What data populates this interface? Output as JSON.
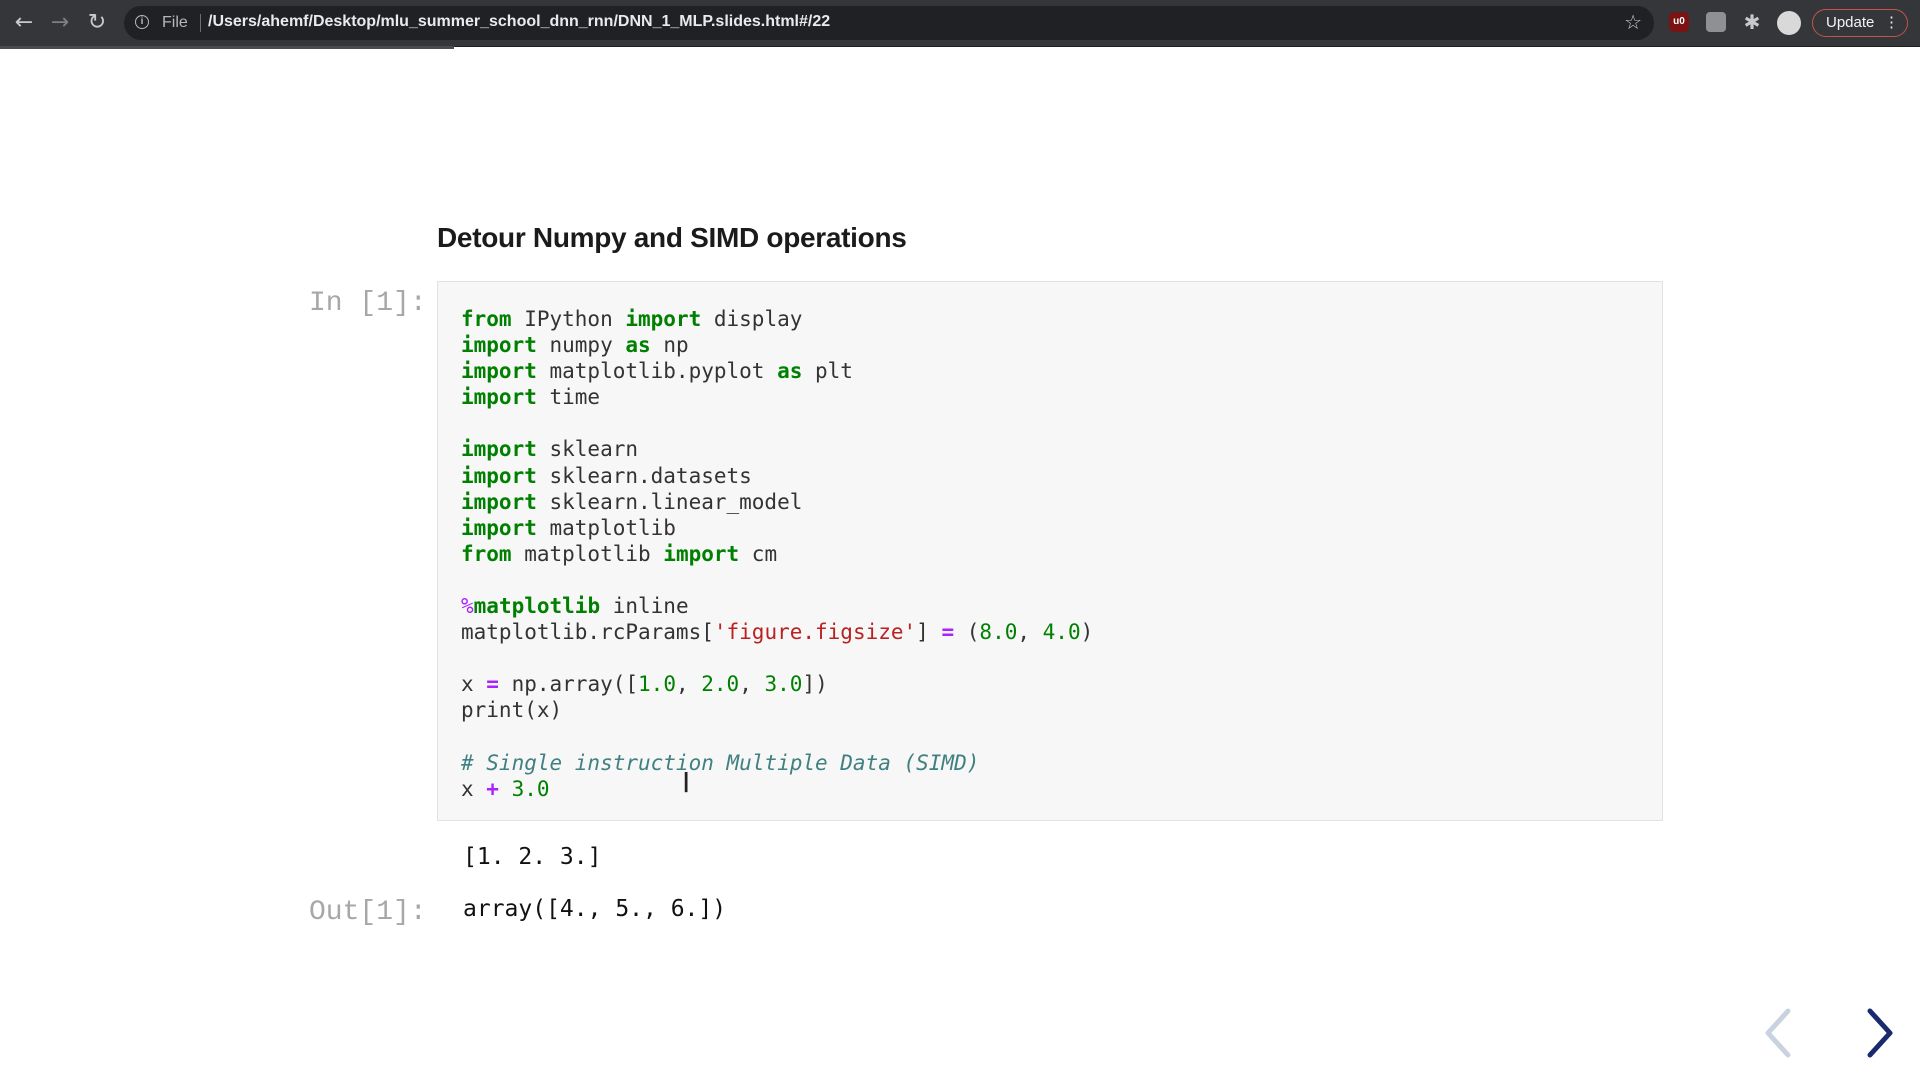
{
  "browser": {
    "scheme_label": "File",
    "url": "/Users/ahemf/Desktop/mlu_summer_school_dnn_rnn/DNN_1_MLP.slides.html#/22",
    "update_label": "Update",
    "ublock_label": "u0"
  },
  "slide": {
    "title": "Detour Numpy and SIMD operations",
    "in_prompt": "In [1]:",
    "out_prompt": "Out[1]:",
    "stdout": "[1. 2. 3.]",
    "result": "array([4., 5., 6.])"
  },
  "code_lines": [
    "from IPython import display",
    "import numpy as np",
    "import matplotlib.pyplot as plt",
    "import time",
    "",
    "import sklearn",
    "import sklearn.datasets",
    "import sklearn.linear_model",
    "import matplotlib",
    "from matplotlib import cm",
    "",
    "%matplotlib inline",
    "matplotlib.rcParams['figure.figsize'] = (8.0, 4.0)",
    "",
    "x = np.array([1.0, 2.0, 3.0])",
    "print(x)",
    "",
    "# Single instruction Multiple Data (SIMD)",
    "x + 3.0"
  ],
  "colors": {
    "keyword": "#008000",
    "string": "#ba2121",
    "comment": "#408080",
    "operator": "#aa22ff",
    "prompt": "#a7a7a7",
    "chrome": "#35363a"
  }
}
